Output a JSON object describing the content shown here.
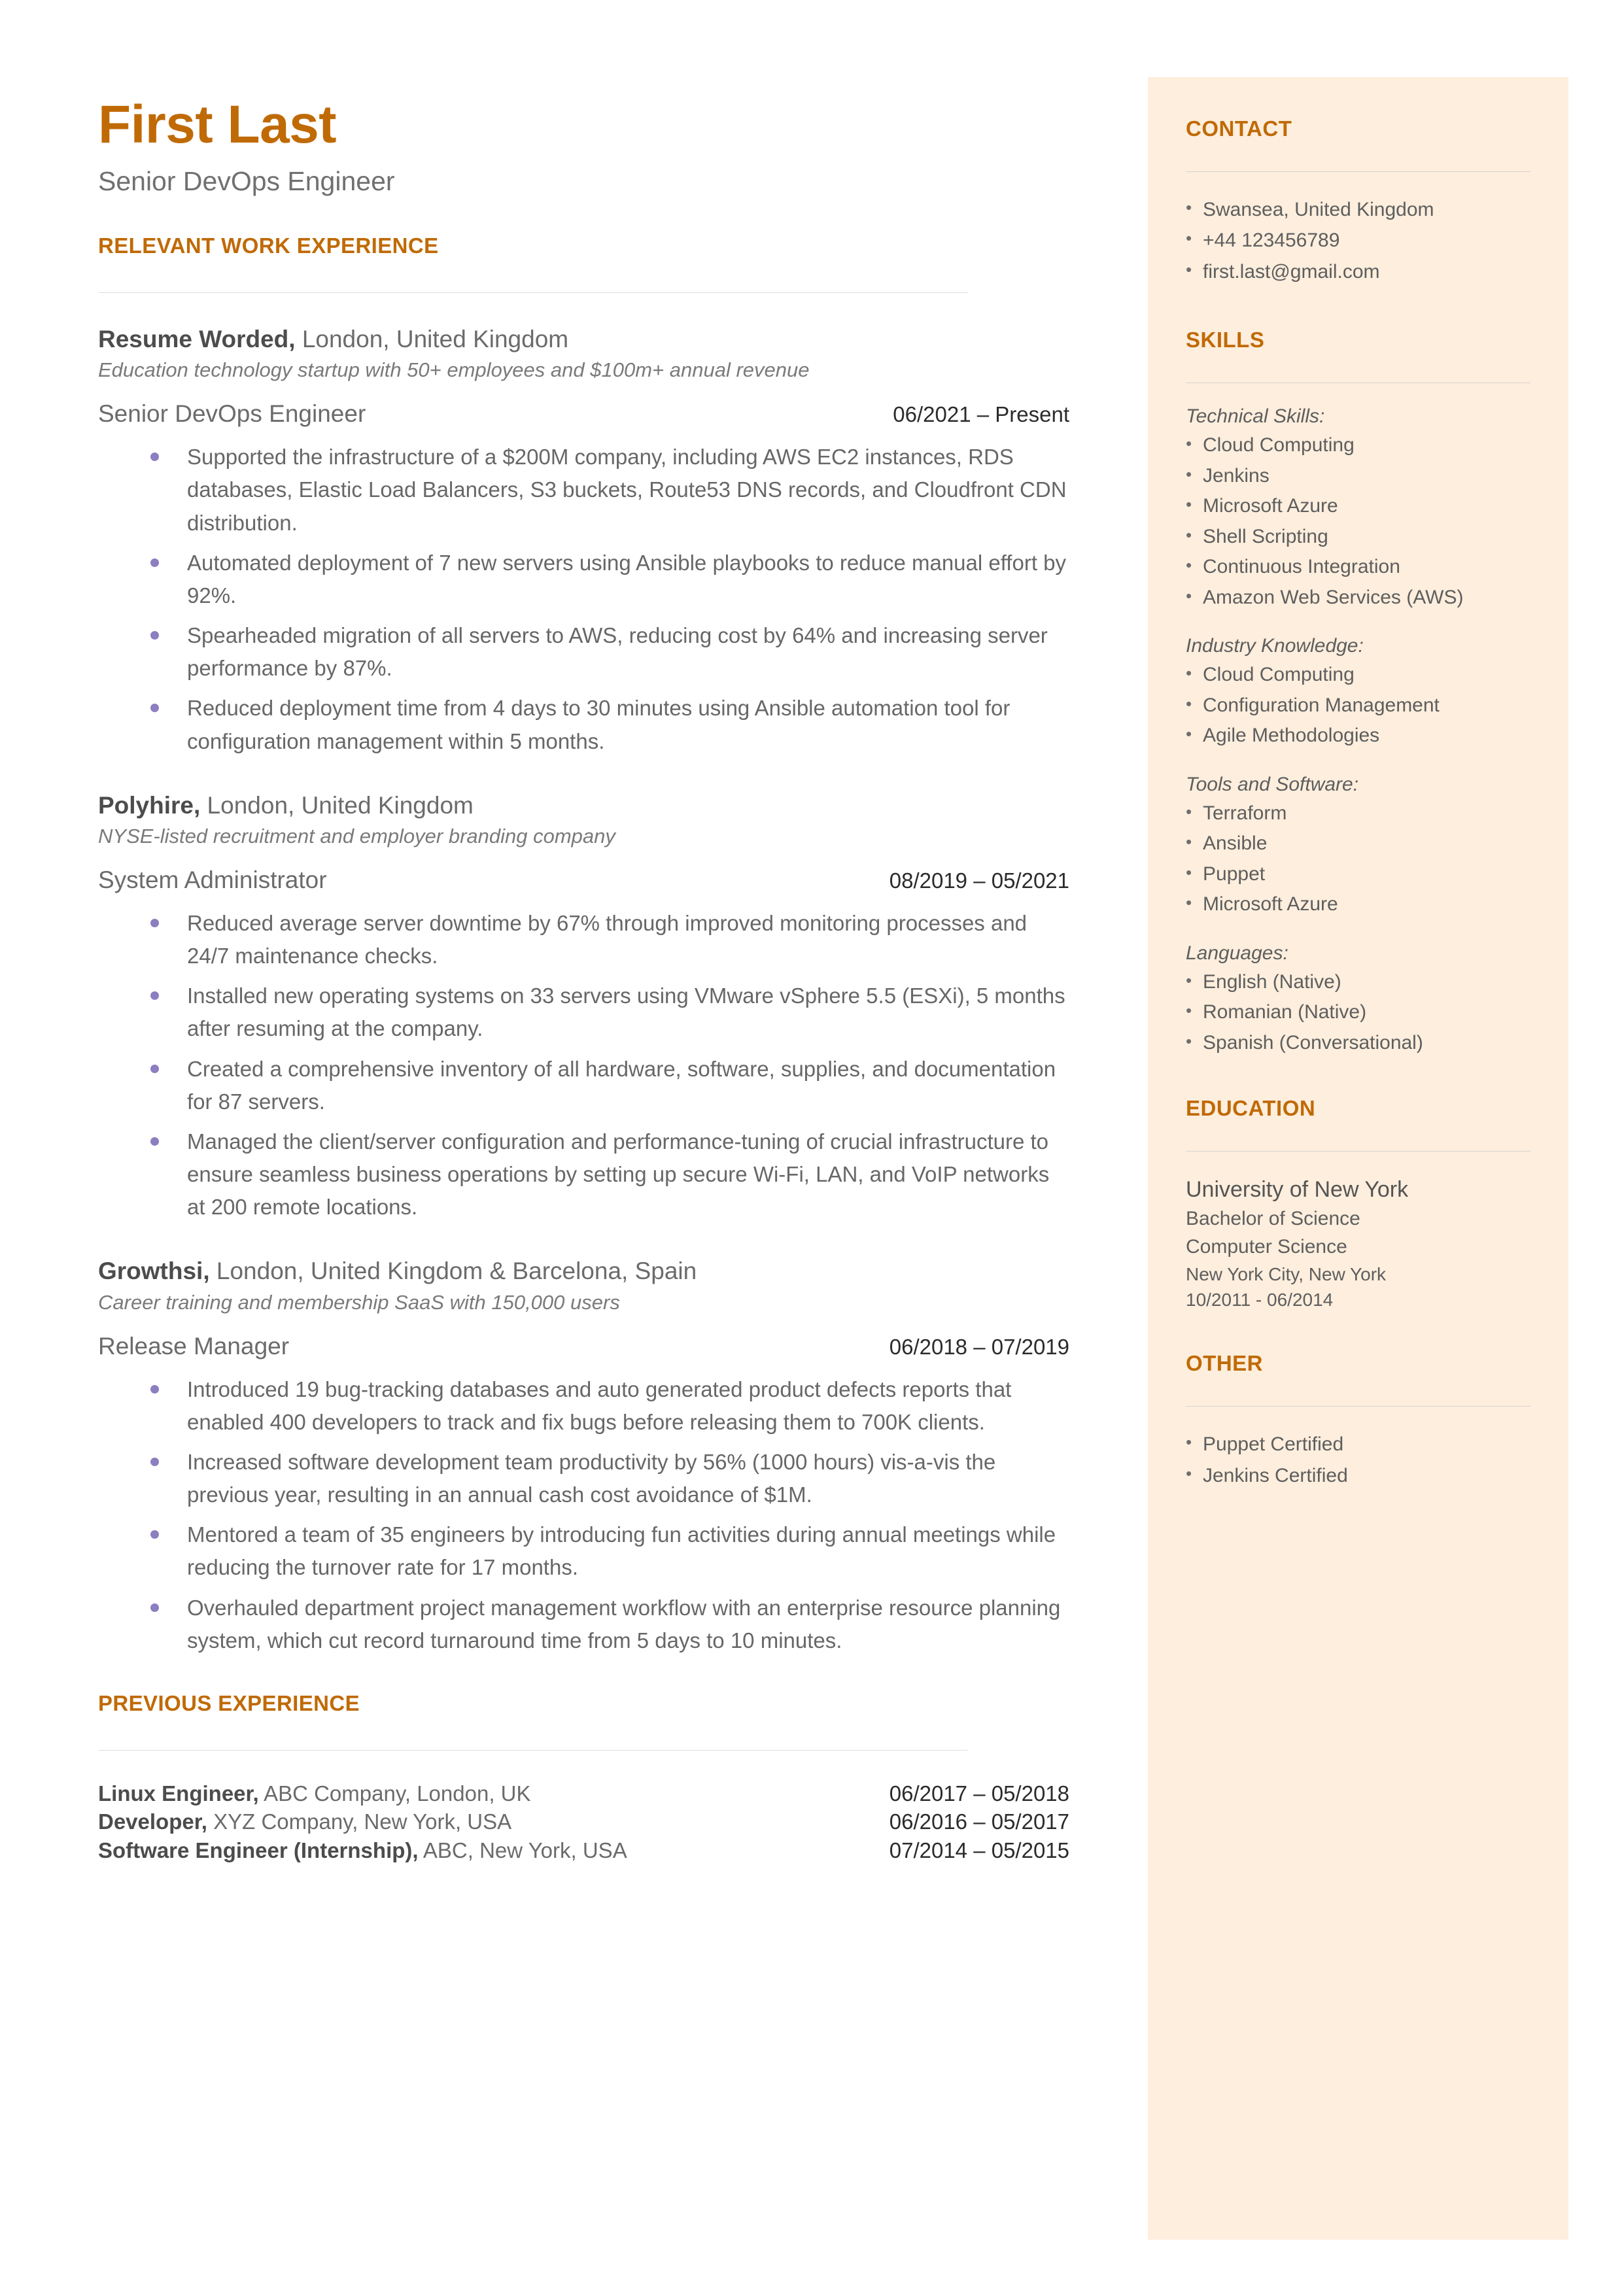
{
  "colors": {
    "accent": "#c06a06",
    "sidebar_bg": "#fdeedd",
    "body_text": "#676767",
    "bullet": "#8c7ec0"
  },
  "header": {
    "name": "First Last",
    "headline": "Senior DevOps Engineer"
  },
  "main": {
    "work_heading": "RELEVANT WORK EXPERIENCE",
    "previous_heading": "PREVIOUS EXPERIENCE",
    "jobs": [
      {
        "company": "Resume Worded,",
        "location": " London, United Kingdom",
        "description": "Education technology startup with 50+ employees and $100m+ annual revenue",
        "title": "Senior DevOps Engineer",
        "dates": "06/2021 – Present",
        "bullets": [
          "Supported the infrastructure of a $200M company, including AWS EC2 instances, RDS databases, Elastic Load Balancers, S3 buckets, Route53 DNS records, and Cloudfront CDN distribution.",
          "Automated deployment of 7 new servers using Ansible playbooks to reduce manual effort by 92%.",
          "Spearheaded migration of all servers to AWS, reducing cost by 64% and increasing server performance by 87%.",
          "Reduced deployment time from 4 days to 30 minutes using Ansible automation tool for configuration management within 5 months."
        ]
      },
      {
        "company": "Polyhire,",
        "location": " London, United Kingdom",
        "description": "NYSE-listed recruitment and employer branding company",
        "title": "System Administrator",
        "dates": "08/2019 – 05/2021",
        "bullets": [
          "Reduced average server downtime by 67% through improved monitoring processes and 24/7 maintenance checks.",
          "Installed new operating systems on 33 servers using VMware vSphere 5.5 (ESXi), 5 months after resuming at the company.",
          "Created a comprehensive inventory of all hardware, software, supplies, and documentation for 87 servers.",
          "Managed the client/server configuration and performance-tuning of crucial infrastructure to ensure seamless business operations by setting up secure Wi-Fi, LAN, and VoIP networks at 200 remote locations."
        ]
      },
      {
        "company": "Growthsi,",
        "location": " London, United Kingdom & Barcelona, Spain",
        "description": "Career training and membership SaaS with 150,000 users",
        "title": "Release Manager",
        "dates": "06/2018 – 07/2019",
        "bullets": [
          "Introduced 19 bug-tracking databases and auto generated product defects reports that enabled 400 developers to track and fix bugs before releasing them to 700K clients.",
          "Increased software development team productivity by 56% (1000 hours) vis-a-vis the previous year, resulting in an annual cash cost avoidance of $1M.",
          "Mentored a team of 35 engineers by introducing fun activities during annual meetings while reducing the turnover rate for 17 months.",
          "Overhauled department project management workflow with an enterprise resource planning system, which cut record turnaround time from 5 days to 10 minutes."
        ]
      }
    ],
    "previous_jobs": [
      {
        "title": "Linux Engineer,",
        "detail": " ABC Company, London, UK",
        "dates": "06/2017 – 05/2018"
      },
      {
        "title": "Developer,",
        "detail": " XYZ Company, New York, USA",
        "dates": "06/2016 – 05/2017"
      },
      {
        "title": "Software Engineer (Internship),",
        "detail": " ABC, New York, USA",
        "dates": "07/2014 – 05/2015"
      }
    ]
  },
  "sidebar": {
    "contact": {
      "heading": "CONTACT",
      "items": [
        "Swansea, United Kingdom",
        "+44 123456789",
        "first.last@gmail.com"
      ]
    },
    "skills": {
      "heading": "SKILLS",
      "groups": [
        {
          "label": "Technical Skills:",
          "items": [
            "Cloud Computing",
            "Jenkins",
            "Microsoft Azure",
            "Shell Scripting",
            "Continuous Integration",
            "Amazon Web Services (AWS)"
          ]
        },
        {
          "label": "Industry Knowledge:",
          "items": [
            "Cloud Computing",
            "Configuration Management",
            "Agile Methodologies"
          ]
        },
        {
          "label": "Tools and Software:",
          "items": [
            "Terraform",
            "Ansible",
            "Puppet",
            "Microsoft Azure"
          ]
        },
        {
          "label": "Languages:",
          "items": [
            "English (Native)",
            "Romanian (Native)",
            "Spanish (Conversational)"
          ]
        }
      ]
    },
    "education": {
      "heading": "EDUCATION",
      "school": "University of New York",
      "degree": "Bachelor of Science",
      "field": "Computer Science",
      "location": "New York City, New York",
      "dates": "10/2011 - 06/2014"
    },
    "other": {
      "heading": "OTHER",
      "items": [
        "Puppet Certified",
        "Jenkins Certified"
      ]
    }
  }
}
